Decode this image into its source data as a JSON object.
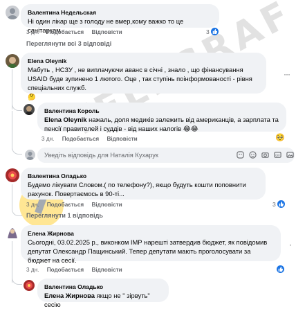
{
  "colors": {
    "bubble": "#f0f2f5",
    "meta": "#65676b",
    "like": "#1b74e4",
    "text": "#050505"
  },
  "comments": [
    {
      "author": "Валентина Недельская",
      "text": "Ні один лікар ще з голоду не вмер,кому важко то це санітаркам",
      "time": "3 дн.",
      "like": "Подобається",
      "reply": "Відповісти",
      "likes": "3",
      "view_replies": "Переглянути всі 3 відповіді"
    },
    {
      "author": "Elena Oleynik",
      "text": "Мабуть , НСЗУ , не виплачуючи аванс в січні , знало , що фінансування USAID буде зупинено 1 лютого. Оце , так ступінь поінформованості - рівня спеціальних служб.",
      "emoji": "🤔",
      "reply_block": {
        "author": "Валентина Король",
        "tag": "Elena Oleynik",
        "text": "нажаль, доля медиків залежить від американців, а зарплата та пенсії правителей і суддів - від наших налогів",
        "emoji": "😂😂",
        "time": "3 дн.",
        "like": "Подобається",
        "reply": "Відповісти",
        "reaction": "🥺"
      },
      "reply_placeholder": "Уведіть відповідь для Наталія Кухарук"
    },
    {
      "author": "Валентина Оладько",
      "text": "Будемо лікувати Словом.( по телефону?), якщо будуть кошти поповнити рахунок. Повертаємось в 90-ті...",
      "time": "3 дн.",
      "like": "Подобається",
      "reply": "Відповісти",
      "likes": "3",
      "view_replies": "Переглянути 1 відповідь"
    },
    {
      "author": "Елена Жирнова",
      "text": "Сьогодні, 03.02.2025 р., виконком ІМР нарешті затвердив бюджет, як повідомив депутат Олександр Пащинський. Тепер депутати мають проголосувати за бюджет на сесії.",
      "time": "3 дн.",
      "like": "Подобається",
      "reply": "Відповісти",
      "reply_block": {
        "author": "Валентина Оладько",
        "tag": "Елена Жирнова",
        "text": "якщо не \" зірвуть\" сесію"
      }
    }
  ],
  "watermark": "TELEGRAF",
  "icons": {
    "input_icons": [
      "sticker-icon",
      "emoji-icon",
      "camera-icon",
      "gif-icon",
      "image-icon"
    ]
  }
}
